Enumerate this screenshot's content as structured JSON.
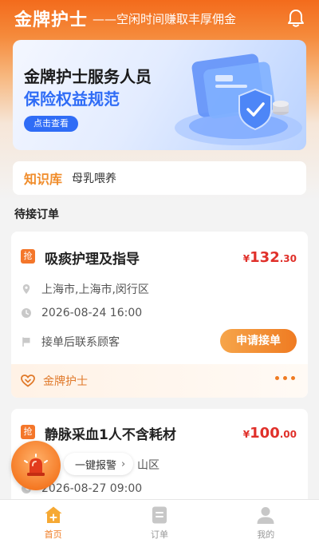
{
  "header": {
    "brand": "金牌护士",
    "slogan": "——空闲时间赚取丰厚佣金",
    "bell_icon": "bell-icon"
  },
  "banner": {
    "line1": "金牌护士服务人员",
    "line2": "保险权益规范",
    "cta": "点击查看"
  },
  "knowledge": {
    "title": "知识库",
    "topic": "母乳喂养"
  },
  "section_title": "待接订单",
  "orders": [
    {
      "badge": "抢",
      "title": "吸痰护理及指导",
      "price_currency": "¥",
      "price_int": "132",
      "price_dec": ".30",
      "location": "上海市,上海市,闵行区",
      "datetime": "2026-08-24  16:00",
      "contact": "接单后联系顾客",
      "apply_label": "申请接单",
      "provider": "金牌护士"
    },
    {
      "badge": "抢",
      "title": "静脉采血1人不含耗材",
      "price_currency": "¥",
      "price_int": "100",
      "price_dec": ".00",
      "location_partial": "山区",
      "datetime": "2026-08-27  09:00"
    }
  ],
  "alarm": {
    "label": "一键报警",
    "chevron": "›"
  },
  "tabs": [
    {
      "label": "首页",
      "icon": "home-icon",
      "active": true
    },
    {
      "label": "订单",
      "icon": "order-icon",
      "active": false
    },
    {
      "label": "我的",
      "icon": "user-icon",
      "active": false
    }
  ],
  "colors": {
    "accent": "#ef7b22",
    "price": "#e0302a",
    "banner_blue": "#2f6cf6"
  }
}
